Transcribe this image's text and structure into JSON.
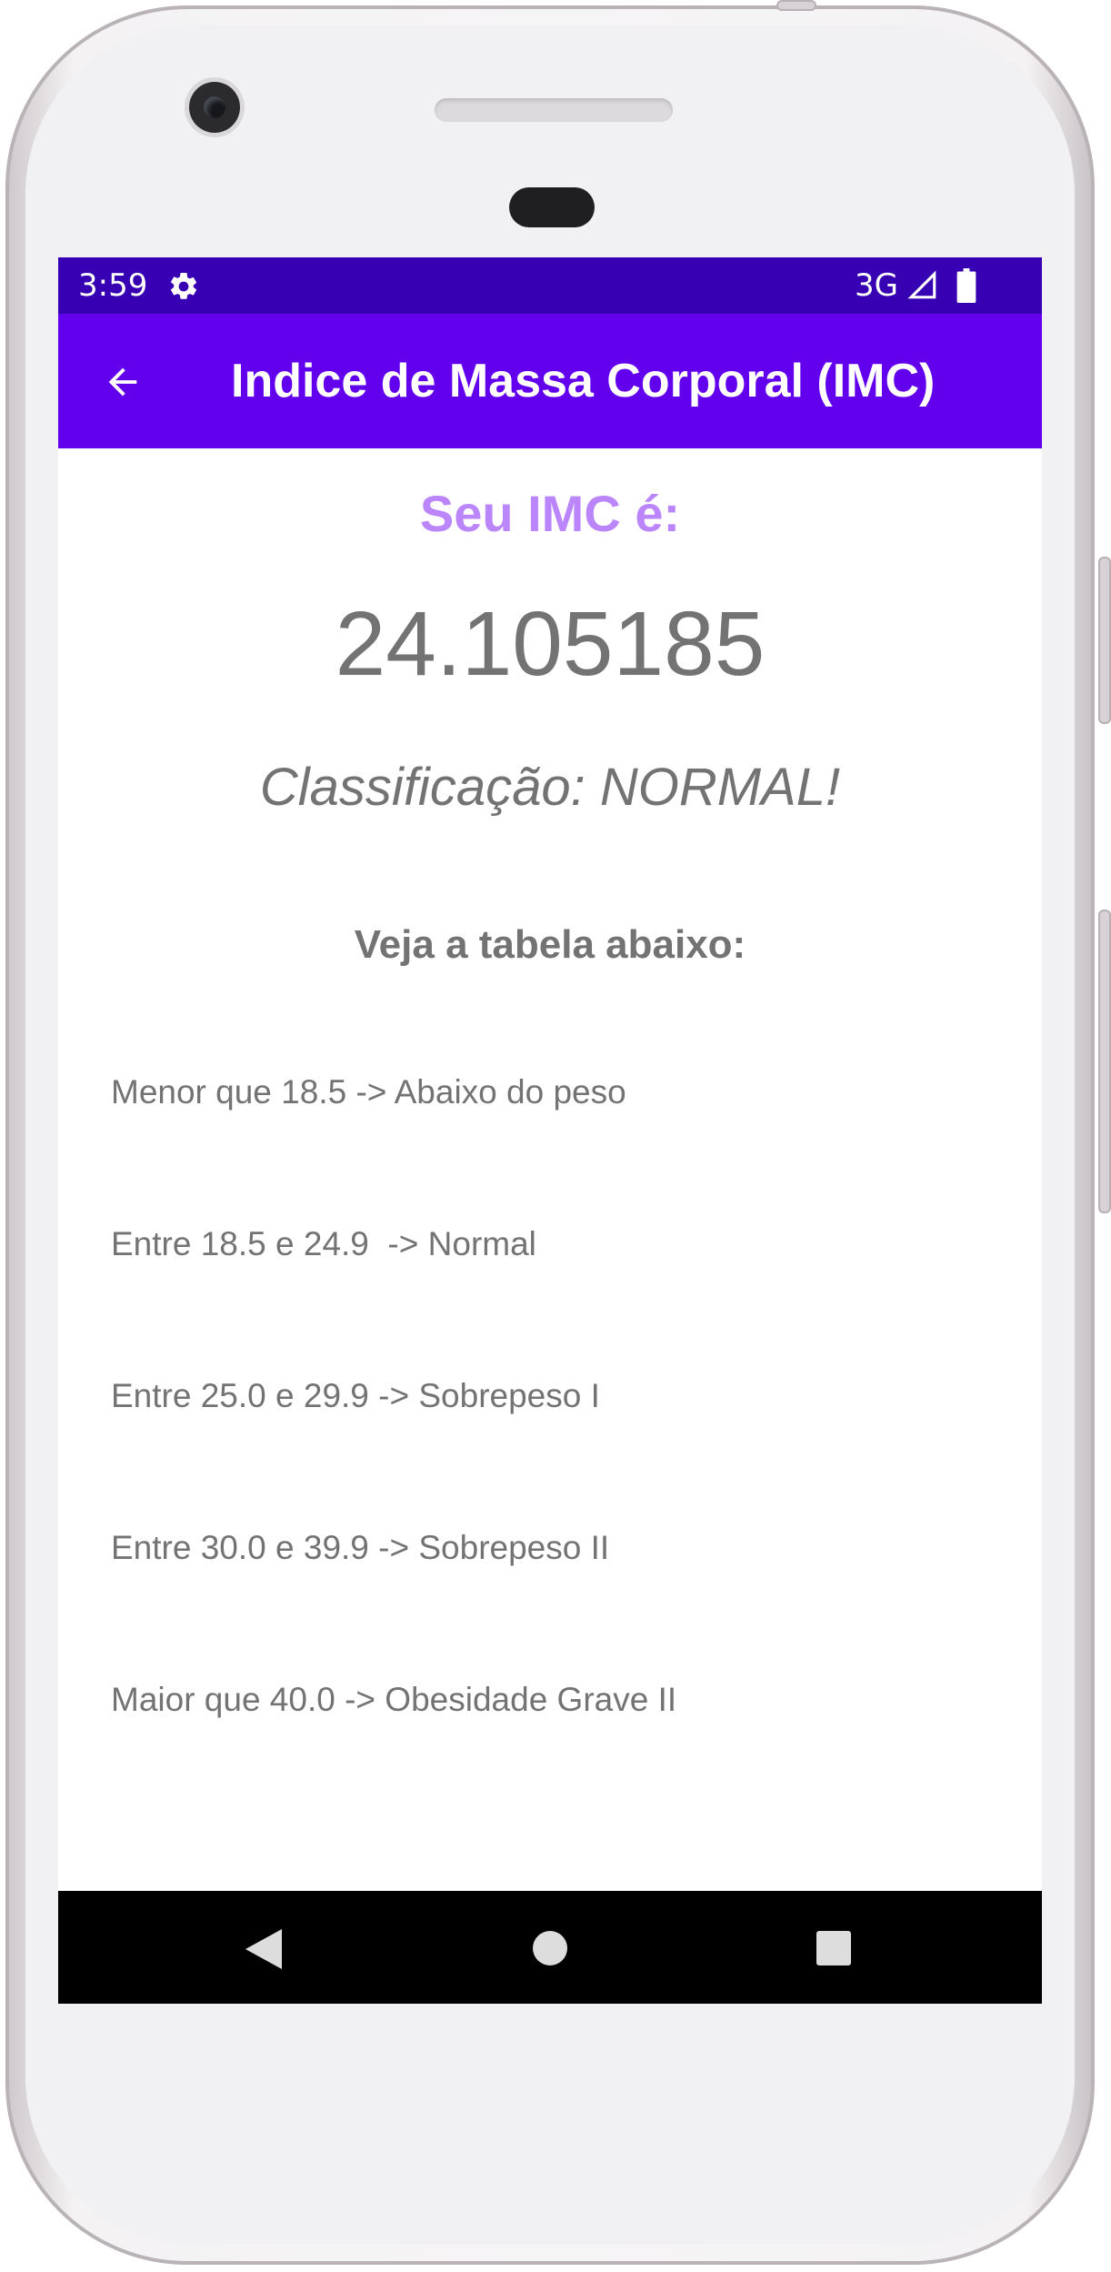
{
  "status_bar": {
    "time": "3:59",
    "network": "3G",
    "icons": [
      "settings-gear-icon",
      "cell-signal-icon",
      "battery-icon"
    ]
  },
  "app_bar": {
    "title": "Indice de Massa Corporal (IMC)",
    "back_icon": "arrow-back-icon"
  },
  "result": {
    "label": "Seu IMC é:",
    "value": "24.105185",
    "classification": "Classificação: NORMAL!"
  },
  "table": {
    "heading": "Veja a tabela abaixo:",
    "rows": [
      "Menor que 18.5 -> Abaixo do peso",
      "Entre 18.5 e 24.9  -> Normal",
      "Entre 25.0 e 29.9 -> Sobrepeso I",
      "Entre 30.0 e 39.9 -> Sobrepeso II",
      "Maior que 40.0 -> Obesidade Grave II"
    ]
  },
  "nav_bar": {
    "icons": [
      "nav-back-icon",
      "nav-home-icon",
      "nav-recents-icon"
    ]
  },
  "colors": {
    "status_bar": "#3700b3",
    "app_bar": "#6200ee",
    "accent_label": "#bb86fc",
    "text_gray": "#737373"
  }
}
